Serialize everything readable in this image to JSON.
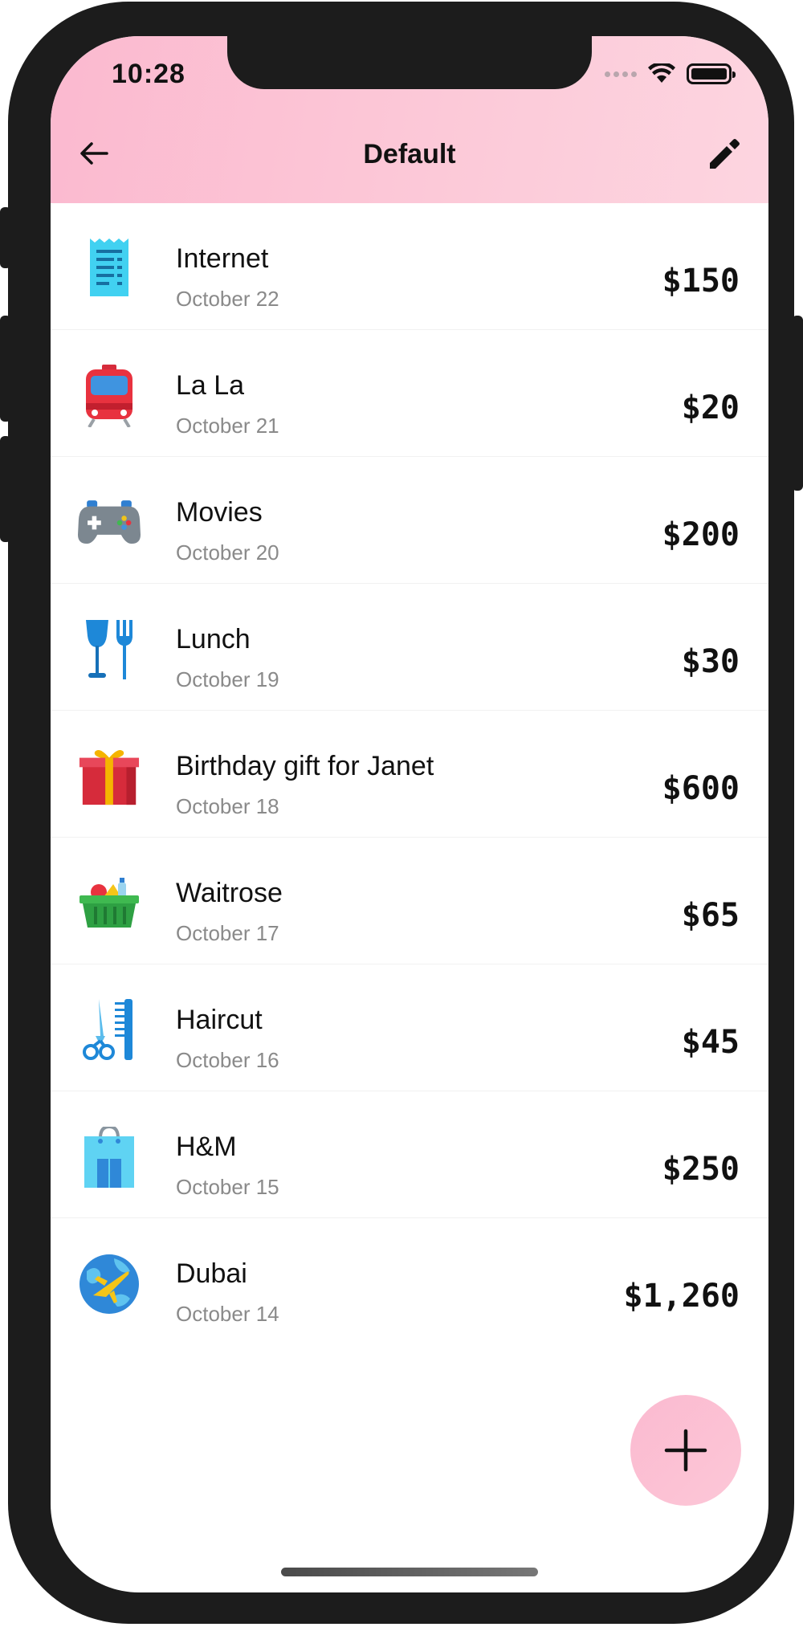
{
  "status_bar": {
    "time": "10:28"
  },
  "header": {
    "title": "Default",
    "back_icon": "arrow-left-icon",
    "edit_icon": "pencil-icon",
    "background_start": "#fbb9cf",
    "background_end": "#fdd5e0"
  },
  "transactions": [
    {
      "title": "Internet",
      "date": "October 22",
      "amount": "$150",
      "icon": "receipt-icon"
    },
    {
      "title": "La La",
      "date": "October 21",
      "amount": "$20",
      "icon": "train-icon"
    },
    {
      "title": "Movies",
      "date": "October 20",
      "amount": "$200",
      "icon": "gamepad-icon"
    },
    {
      "title": "Lunch",
      "date": "October 19",
      "amount": "$30",
      "icon": "glass-fork-icon"
    },
    {
      "title": "Birthday gift for Janet",
      "date": "October 18",
      "amount": "$600",
      "icon": "gift-icon"
    },
    {
      "title": "Waitrose",
      "date": "October 17",
      "amount": "$65",
      "icon": "grocery-basket-icon"
    },
    {
      "title": "Haircut",
      "date": "October 16",
      "amount": "$45",
      "icon": "scissors-comb-icon"
    },
    {
      "title": "H&M",
      "date": "October 15",
      "amount": "$250",
      "icon": "shopping-bag-icon"
    },
    {
      "title": "Dubai",
      "date": "October 14",
      "amount": "$1,260",
      "icon": "globe-plane-icon"
    }
  ],
  "fab": {
    "icon": "plus-icon",
    "color": "#fbbad0"
  }
}
